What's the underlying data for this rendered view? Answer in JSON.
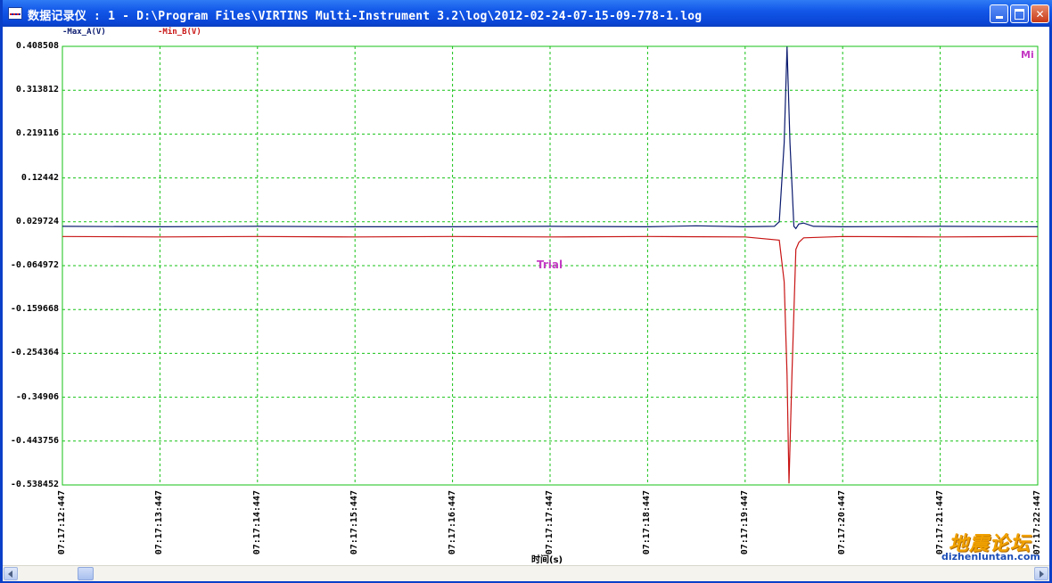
{
  "window": {
    "title": "数据记录仪 : 1 - D:\\Program Files\\VIRTINS Multi-Instrument 3.2\\log\\2012-02-24-07-15-09-778-1.log",
    "icon": "data-logger-icon",
    "accent_color": "#0a45d6"
  },
  "legend": {
    "series_a": "-Max_A(V)",
    "series_b": "-Min_B(V)"
  },
  "labels": {
    "trial": "Trial",
    "corner": "Mi"
  },
  "watermark": {
    "name": "地震论坛",
    "url": "dizhenluntan.com"
  },
  "chart_data": {
    "type": "line",
    "xlabel": "时间(s)",
    "ylim": [
      -0.538452,
      0.408508
    ],
    "y_ticks": [
      "0.408508",
      "0.313812",
      "0.219116",
      "0.12442",
      "0.029724",
      "-0.064972",
      "-0.159668",
      "-0.254364",
      "-0.34906",
      "-0.443756",
      "-0.538452"
    ],
    "x_ticks": [
      "07:17:12:447",
      "07:17:13:447",
      "07:17:14:447",
      "07:17:15:447",
      "07:17:16:447",
      "07:17:17:447",
      "07:17:18:447",
      "07:17:19:447",
      "07:17:20:447",
      "07:17:21:447",
      "07:17:22:447"
    ],
    "grid": true,
    "series": [
      {
        "name": "Max_A(V)",
        "color": "#0a1a6e",
        "points": [
          [
            0,
            0.02
          ],
          [
            1,
            0.019
          ],
          [
            2,
            0.02
          ],
          [
            3,
            0.019
          ],
          [
            4,
            0.019
          ],
          [
            5,
            0.02
          ],
          [
            6,
            0.019
          ],
          [
            6.5,
            0.021
          ],
          [
            7,
            0.019
          ],
          [
            7.3,
            0.02
          ],
          [
            7.35,
            0.03
          ],
          [
            7.4,
            0.2
          ],
          [
            7.43,
            0.408
          ],
          [
            7.46,
            0.2
          ],
          [
            7.5,
            0.02
          ],
          [
            7.52,
            0.015
          ],
          [
            7.55,
            0.025
          ],
          [
            7.6,
            0.027
          ],
          [
            7.7,
            0.02
          ],
          [
            8,
            0.019
          ],
          [
            9,
            0.02
          ],
          [
            10,
            0.019
          ]
        ]
      },
      {
        "name": "Min_B(V)",
        "color": "#c81414",
        "points": [
          [
            0,
            -0.002
          ],
          [
            1,
            -0.003
          ],
          [
            2,
            -0.002
          ],
          [
            3,
            -0.003
          ],
          [
            4,
            -0.002
          ],
          [
            5,
            -0.003
          ],
          [
            6,
            -0.002
          ],
          [
            7,
            -0.003
          ],
          [
            7.35,
            -0.01
          ],
          [
            7.4,
            -0.1
          ],
          [
            7.43,
            -0.3
          ],
          [
            7.45,
            -0.535
          ],
          [
            7.48,
            -0.3
          ],
          [
            7.52,
            -0.03
          ],
          [
            7.55,
            -0.015
          ],
          [
            7.6,
            -0.005
          ],
          [
            8,
            -0.002
          ],
          [
            9,
            -0.003
          ],
          [
            10,
            -0.002
          ]
        ]
      }
    ]
  }
}
